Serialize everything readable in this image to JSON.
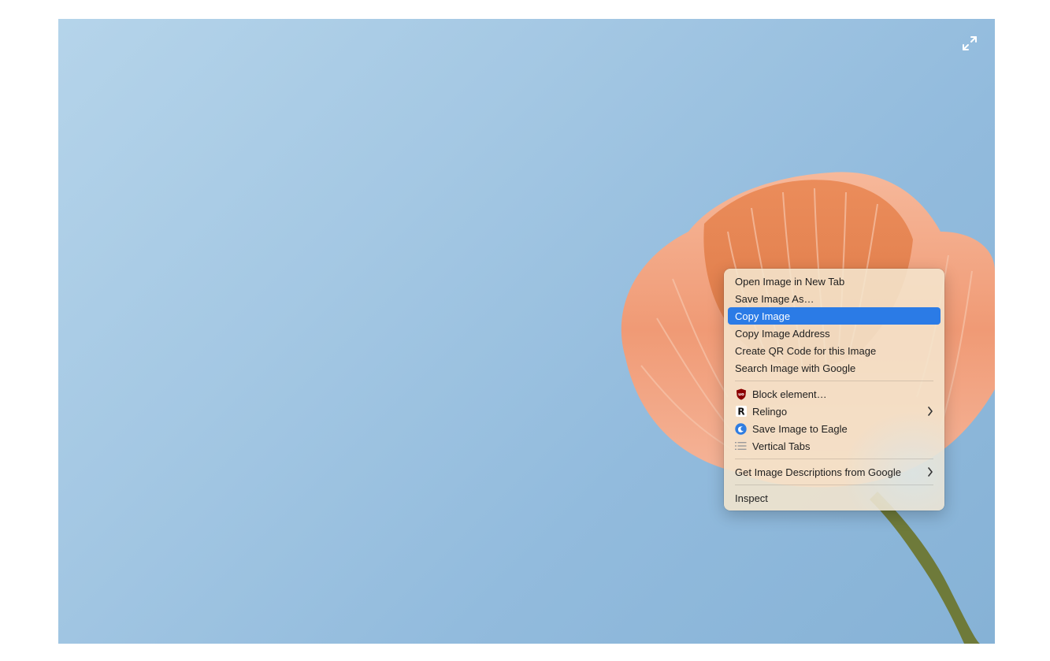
{
  "menu": {
    "open_new_tab": "Open Image in New Tab",
    "save_as": "Save Image As…",
    "copy_image": "Copy Image",
    "copy_address": "Copy Image Address",
    "create_qr": "Create QR Code for this Image",
    "search_google": "Search Image with Google",
    "block_element": "Block element…",
    "relingo": "Relingo",
    "save_eagle": "Save Image to Eagle",
    "vertical_tabs": "Vertical Tabs",
    "image_descriptions": "Get Image Descriptions from Google",
    "inspect": "Inspect"
  },
  "icons": {
    "expand": "expand-icon",
    "ublock": "ublock-icon",
    "relingo": "relingo-icon",
    "eagle": "eagle-icon",
    "vertical_tabs": "list-icon",
    "submenu": "chevron-right-icon"
  },
  "colors": {
    "highlight": "#2b7be6",
    "sky": "#a3c7e3",
    "petal": "#f2a07a",
    "menu_bg": "#f4e5cd"
  }
}
